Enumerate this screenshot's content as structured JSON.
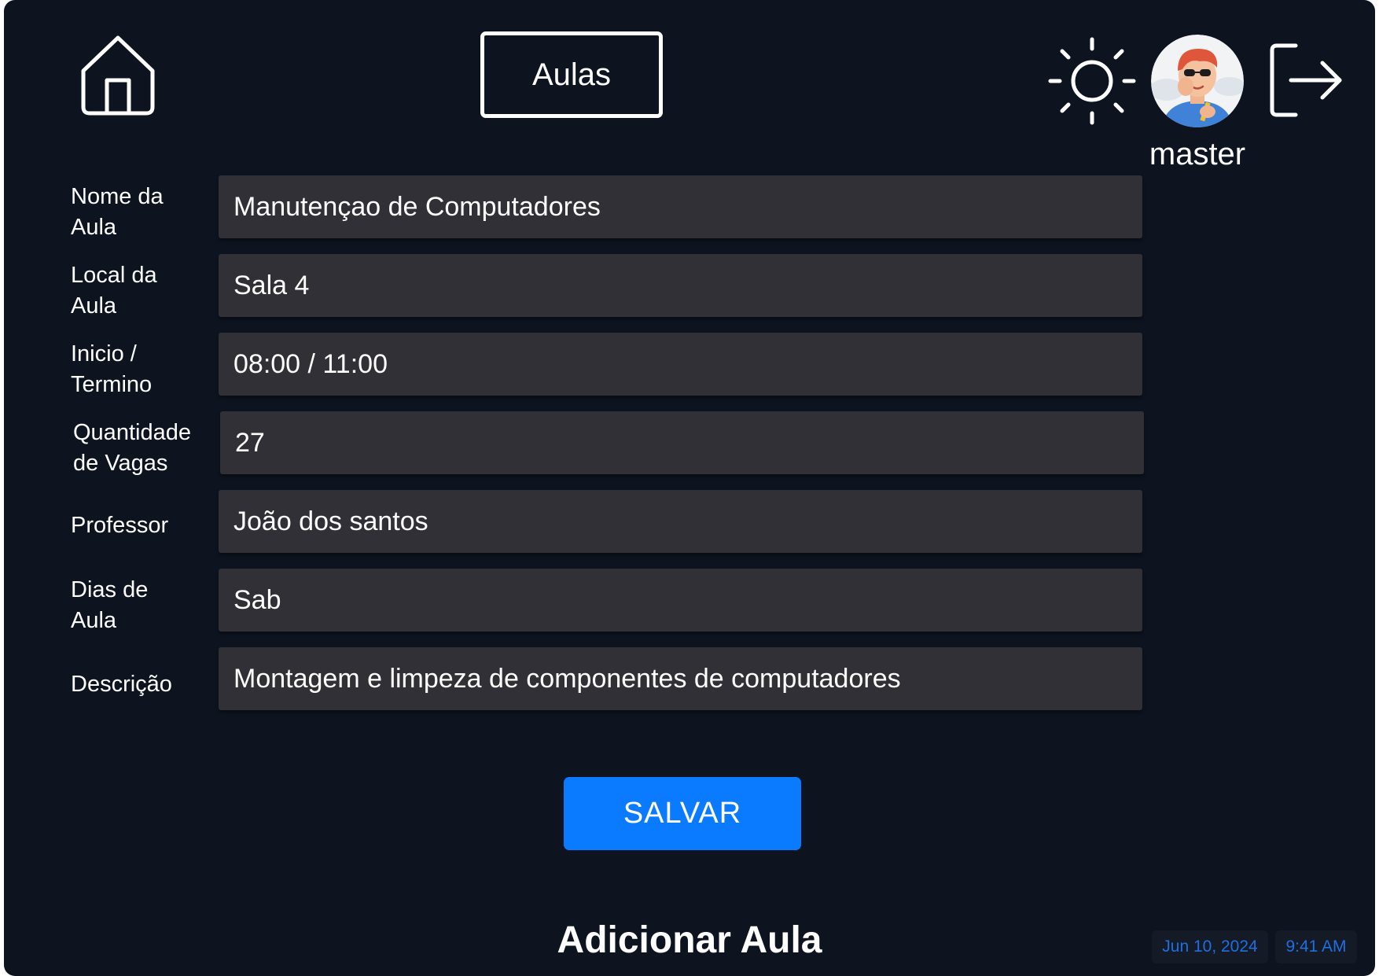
{
  "header": {
    "title": "Aulas",
    "username": "master",
    "icons": {
      "home": "home-icon",
      "theme": "sun-icon",
      "logout": "logout-icon"
    }
  },
  "form": {
    "fields": [
      {
        "label_line1": "Nome da",
        "label_line2": "Aula",
        "value": "Manutençao de Computadores"
      },
      {
        "label_line1": "Local da",
        "label_line2": "Aula",
        "value": "Sala 4"
      },
      {
        "label_line1": "Inicio /",
        "label_line2": "Termino",
        "value": "08:00 / 11:00"
      },
      {
        "label_line1": "Quantidade",
        "label_line2": "de Vagas",
        "value": "27"
      },
      {
        "label_line1": "Professor",
        "label_line2": "",
        "value": "João dos santos"
      },
      {
        "label_line1": "Dias de",
        "label_line2": "Aula",
        "value": "Sab"
      },
      {
        "label_line1": "Descrição",
        "label_line2": "",
        "value": "Montagem e limpeza de componentes de computadores"
      }
    ],
    "save_label": "SALVAR"
  },
  "page_heading": "Adicionar Aula",
  "status": {
    "date": "Jun 10, 2024",
    "time": "9:41 AM"
  },
  "colors": {
    "background": "#0d1420",
    "input_bg": "#313036",
    "accent": "#0a7bff",
    "status_text": "#1f6fe0"
  }
}
